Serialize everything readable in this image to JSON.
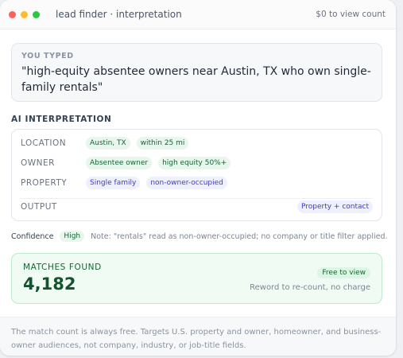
{
  "window": {
    "title": "lead finder · interpretation",
    "cost_note": "$0 to view count",
    "dot_colors": [
      "#ff6058",
      "#ffbd2e",
      "#28c840"
    ]
  },
  "typed": {
    "label": "YOU TYPED",
    "query": "\"high-equity absentee owners near Austin, TX who own single-family rentals\""
  },
  "interpretation": {
    "heading": "AI INTERPRETATION",
    "location": {
      "label": "LOCATION",
      "chips": [
        "Austin, TX",
        "within 25 mi"
      ]
    },
    "owner": {
      "label": "OWNER",
      "chips": [
        "Absentee owner",
        "high equity 50%+"
      ]
    },
    "property": {
      "label": "PROPERTY",
      "chips": [
        "Single family",
        "non-owner-occupied"
      ]
    },
    "output": {
      "label": "OUTPUT",
      "chip": "Property + contact"
    }
  },
  "confidence": {
    "label": "Confidence",
    "level": "High",
    "note": "Note: \"rentals\" read as non-owner-occupied; no company or title filter applied."
  },
  "matches": {
    "label": "MATCHES FOUND",
    "count": "4,182",
    "free_badge": "Free to view",
    "reword_note": "Reword to re-count, no charge"
  },
  "footer": {
    "text": "The match count is always free. Targets U.S. property and owner, homeowner, and business-owner audiences, not company, industry, or job-title fields."
  }
}
